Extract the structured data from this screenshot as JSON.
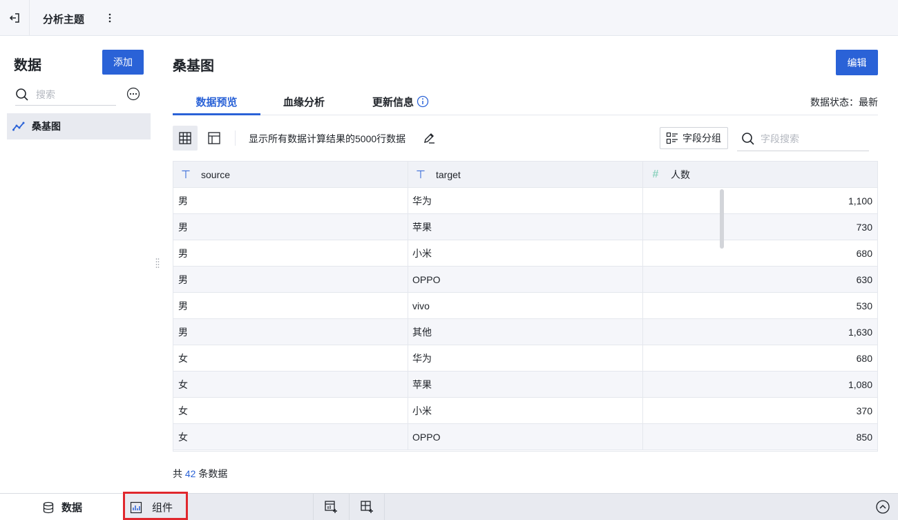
{
  "topbar": {
    "title": "分析主题"
  },
  "sidebar": {
    "heading": "数据",
    "add_label": "添加",
    "search_placeholder": "搜索",
    "items": [
      {
        "label": "桑基图",
        "icon": "line-chart-icon"
      }
    ]
  },
  "main": {
    "title": "桑基图",
    "edit_label": "编辑",
    "tabs": [
      {
        "label": "数据预览",
        "active": true
      },
      {
        "label": "血缘分析"
      },
      {
        "label": "更新信息"
      }
    ],
    "status_text": "数据状态：最新",
    "toolbar": {
      "row_info": "显示所有数据计算结果的5000行数据",
      "group_label": "字段分组",
      "field_search_placeholder": "字段搜索"
    },
    "table": {
      "columns": [
        {
          "name": "source",
          "type": "text"
        },
        {
          "name": "target",
          "type": "text"
        },
        {
          "name": "人数",
          "type": "number"
        }
      ],
      "rows": [
        [
          "男",
          "华为",
          "1,100"
        ],
        [
          "男",
          "苹果",
          "730"
        ],
        [
          "男",
          "小米",
          "680"
        ],
        [
          "男",
          "OPPO",
          "630"
        ],
        [
          "男",
          "vivo",
          "530"
        ],
        [
          "男",
          "其他",
          "1,630"
        ],
        [
          "女",
          "华为",
          "680"
        ],
        [
          "女",
          "苹果",
          "1,080"
        ],
        [
          "女",
          "小米",
          "370"
        ],
        [
          "女",
          "OPPO",
          "850"
        ]
      ]
    },
    "footer": {
      "prefix": "共 ",
      "count": "42",
      "suffix": " 条数据"
    }
  },
  "bottombar": {
    "data_label": "数据",
    "widget_label": "组件"
  },
  "colors": {
    "accent": "#2a62d7",
    "highlight_box": "#e0272d"
  }
}
